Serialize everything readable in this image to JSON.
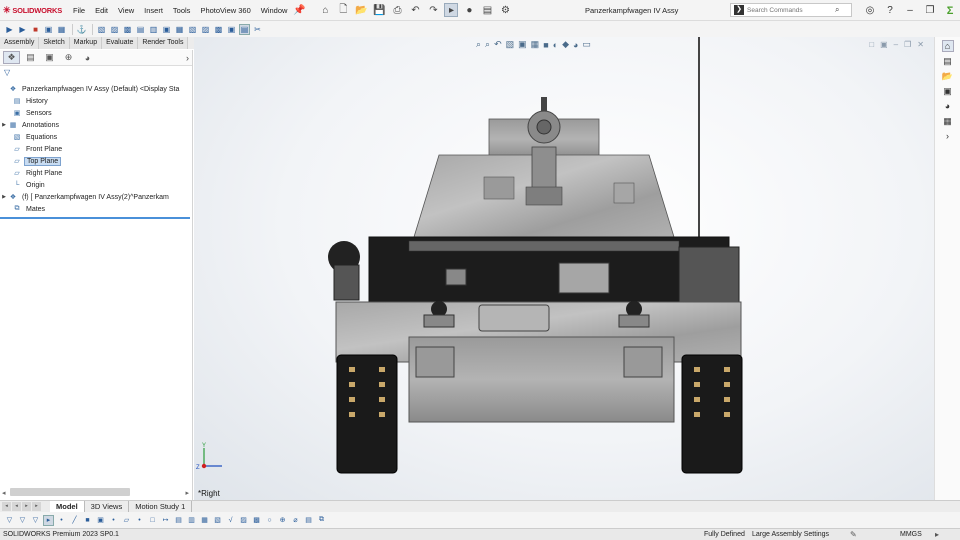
{
  "app": {
    "brand": "SOLIDWORKS",
    "title": "Panzerkampfwagen IV Assy",
    "menus": [
      "File",
      "Edit",
      "View",
      "Insert",
      "Tools",
      "PhotoView 360",
      "Window"
    ],
    "search_placeholder": "Search Commands"
  },
  "command_tabs": [
    "Assembly",
    "Sketch",
    "Markup",
    "Evaluate",
    "Render Tools"
  ],
  "feature_tree": {
    "root": "Panzerkampfwagen IV Assy (Default) <Display Sta",
    "items": [
      {
        "label": "History",
        "icon": "history-icon"
      },
      {
        "label": "Sensors",
        "icon": "sensors-icon"
      },
      {
        "label": "Annotations",
        "icon": "annotations-icon",
        "expandable": true
      },
      {
        "label": "Equations",
        "icon": "equations-icon"
      },
      {
        "label": "Front Plane",
        "icon": "plane-icon"
      },
      {
        "label": "Top Plane",
        "icon": "plane-icon",
        "highlighted": true
      },
      {
        "label": "Right Plane",
        "icon": "plane-icon"
      },
      {
        "label": "Origin",
        "icon": "origin-icon"
      },
      {
        "label": "(f) [ Panzerkampfwagen IV Assy(2)^Panzerkam",
        "icon": "subassembly-icon",
        "expandable": true
      },
      {
        "label": "Mates",
        "icon": "mates-icon"
      }
    ]
  },
  "viewport": {
    "view_label": "*Right",
    "triad_y": "Y",
    "triad_z": "Z"
  },
  "bottom_tabs": [
    "Model",
    "3D Views",
    "Motion Study 1"
  ],
  "status": {
    "product": "SOLIDWORKS Premium 2023 SP0.1",
    "state": "Fully Defined",
    "mode": "Large Assembly Settings",
    "units": "MMGS"
  }
}
